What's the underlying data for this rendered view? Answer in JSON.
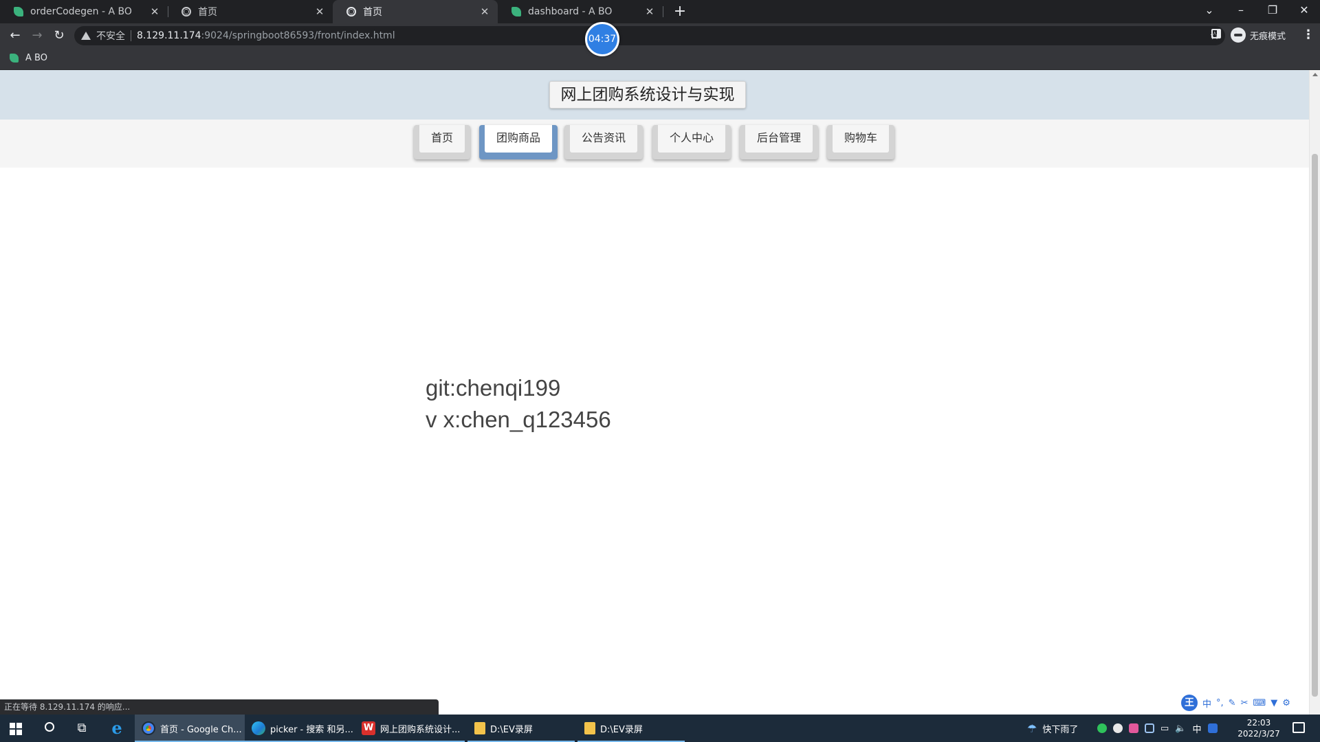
{
  "browser": {
    "tabs": [
      {
        "title": "orderCodegen - A BO",
        "favicon": "leaf-icon",
        "active": false
      },
      {
        "title": "首页",
        "favicon": "globe-icon",
        "active": false
      },
      {
        "title": "首页",
        "favicon": "globe-icon",
        "active": true
      },
      {
        "title": "dashboard - A BO",
        "favicon": "leaf-icon",
        "active": false
      }
    ],
    "new_tab": "+",
    "security_label": "不安全",
    "url_host": "8.129.11.174",
    "url_rest": ":9024/springboot86593/front/index.html",
    "incognito_label": "无痕模式",
    "bookmark": "A BO",
    "status_text": "正在等待 8.129.11.174 的响应..."
  },
  "recorder": {
    "timer": "04:37"
  },
  "site": {
    "title": "网上团购系统设计与实现",
    "nav": [
      {
        "label": "首页",
        "active": false
      },
      {
        "label": "团购商品",
        "active": true
      },
      {
        "label": "公告资讯",
        "active": false
      },
      {
        "label": "个人中心",
        "active": false
      },
      {
        "label": "后台管理",
        "active": false
      },
      {
        "label": "购物车",
        "active": false
      }
    ],
    "contact_lines": [
      "git:chenqi199",
      "v x:chen_q123456"
    ]
  },
  "ime": {
    "logo": "王",
    "items": [
      "中",
      "°,"
    ]
  },
  "taskbar": {
    "apps": [
      {
        "label": "首页 - Google Ch...",
        "icon": "chrome-icon",
        "active": true
      },
      {
        "label": "picker - 搜索 和另...",
        "icon": "edge-icon",
        "active": false
      },
      {
        "label": "网上团购系统设计...",
        "icon": "wps-icon",
        "active": false
      },
      {
        "label": "D:\\EV录屏",
        "icon": "folder-icon",
        "active": false
      },
      {
        "label": "D:\\EV录屏",
        "icon": "folder-icon",
        "active": false
      }
    ],
    "weather": "快下雨了",
    "ime_indicator": "中",
    "clock_time": "22:03",
    "clock_date": "2022/3/27"
  },
  "colors": {
    "header_bg": "#d6e1ea",
    "nav_active_accent": "#6e96c4",
    "taskbar_bg": "#1c2b3a"
  }
}
